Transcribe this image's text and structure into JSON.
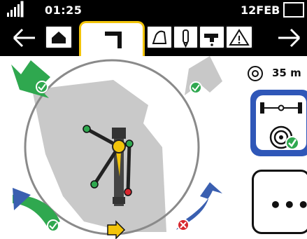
{
  "status": {
    "time": "01:25",
    "date": "12FEB",
    "icons": [
      "signal-bars-icon",
      "battery-icon"
    ]
  },
  "tabs": {
    "nav_back_icon": "arrow-left-icon",
    "nav_forward_icon": "arrow-right-icon",
    "items": [
      {
        "icon": "home-icon",
        "active": false
      },
      {
        "icon": "boom-tool-icon",
        "active": true
      },
      {
        "icon": "bucket-icon",
        "active": false
      },
      {
        "icon": "breaker-icon",
        "active": false
      },
      {
        "icon": "faucet-icon",
        "active": false
      },
      {
        "icon": "warning-triangle-icon",
        "active": false
      }
    ]
  },
  "right_panel": {
    "distance": "35 m",
    "distance_icon": "target-ring-icon",
    "machine_card_icon": "axle-target-check-icon",
    "more_label": "•••"
  },
  "view": {
    "compass_indicator_icon": "direction-arrow-icon",
    "corner_indicators": [
      {
        "position": "top-left",
        "color": "#2fa84f",
        "state": "ok"
      },
      {
        "position": "top-right",
        "color": "#c8c8c8",
        "state": "ok"
      },
      {
        "position": "bottom-left",
        "color": "#2fa84f",
        "state": "ok"
      },
      {
        "position": "bottom-right",
        "color": "#3a5fb0",
        "state": "error"
      }
    ]
  },
  "colors": {
    "accent": "#f2c40a",
    "ok": "#2fa84f",
    "error": "#d8262e",
    "blue": "#3a5fb0"
  }
}
